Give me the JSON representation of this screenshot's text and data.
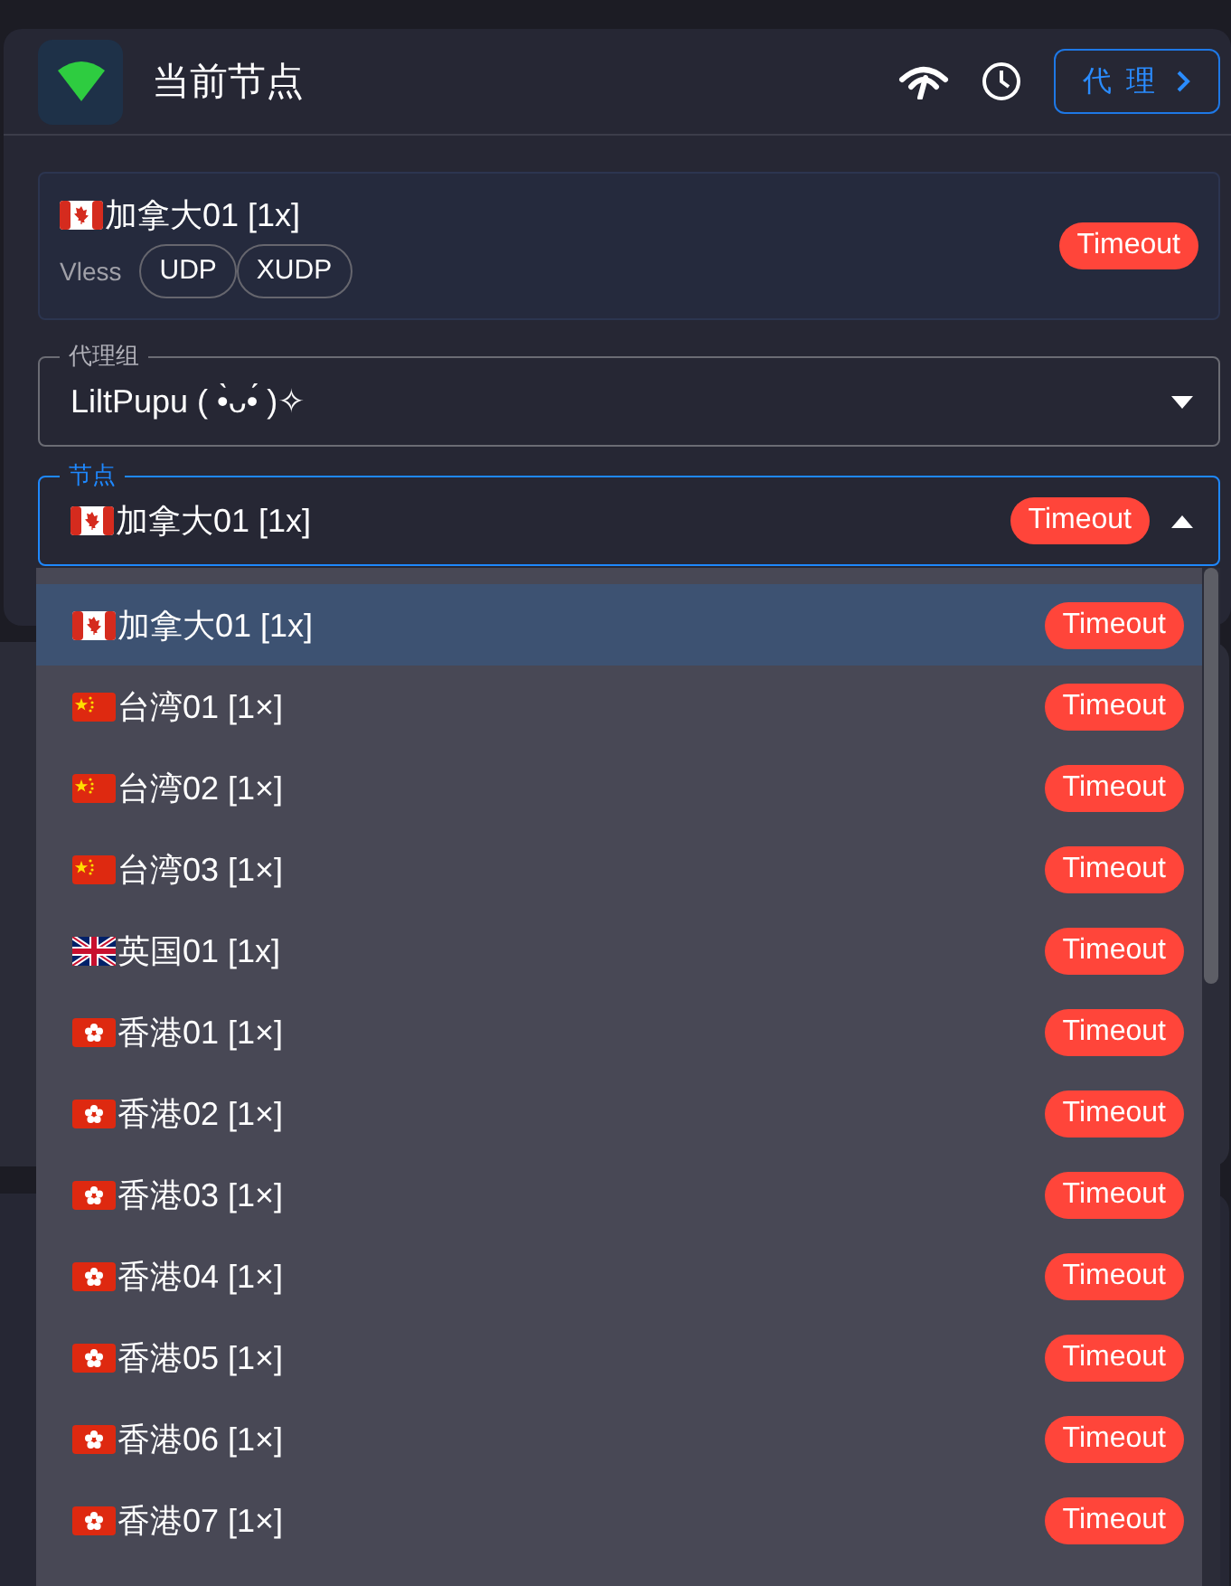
{
  "header": {
    "title": "当前节点",
    "proxy_button": "代 理"
  },
  "current": {
    "name": "加拿大01 [1x]",
    "kind": "ca",
    "protocol": "Vless",
    "tags": [
      "UDP",
      "XUDP"
    ],
    "delay": "Timeout"
  },
  "group_select": {
    "label": "代理组",
    "value": "LiltPupu ( •̀ᴗ•́ )✧",
    "expanded": false
  },
  "node_select": {
    "label": "节点",
    "value": "加拿大01 [1x]",
    "kind": "ca",
    "delay": "Timeout",
    "expanded": true
  },
  "options": [
    {
      "name": "加拿大01 [1x]",
      "kind": "ca",
      "delay": "Timeout",
      "selected": true
    },
    {
      "name": "台湾01 [1×]",
      "kind": "cn",
      "delay": "Timeout",
      "selected": false
    },
    {
      "name": "台湾02 [1×]",
      "kind": "cn",
      "delay": "Timeout",
      "selected": false
    },
    {
      "name": "台湾03 [1×]",
      "kind": "cn",
      "delay": "Timeout",
      "selected": false
    },
    {
      "name": "英国01 [1x]",
      "kind": "gb",
      "delay": "Timeout",
      "selected": false
    },
    {
      "name": "香港01 [1×]",
      "kind": "hk",
      "delay": "Timeout",
      "selected": false
    },
    {
      "name": "香港02 [1×]",
      "kind": "hk",
      "delay": "Timeout",
      "selected": false
    },
    {
      "name": "香港03 [1×]",
      "kind": "hk",
      "delay": "Timeout",
      "selected": false
    },
    {
      "name": "香港04 [1×]",
      "kind": "hk",
      "delay": "Timeout",
      "selected": false
    },
    {
      "name": "香港05 [1×]",
      "kind": "hk",
      "delay": "Timeout",
      "selected": false
    },
    {
      "name": "香港06 [1×]",
      "kind": "hk",
      "delay": "Timeout",
      "selected": false
    },
    {
      "name": "香港07 [1×]",
      "kind": "hk",
      "delay": "Timeout",
      "selected": false
    }
  ]
}
